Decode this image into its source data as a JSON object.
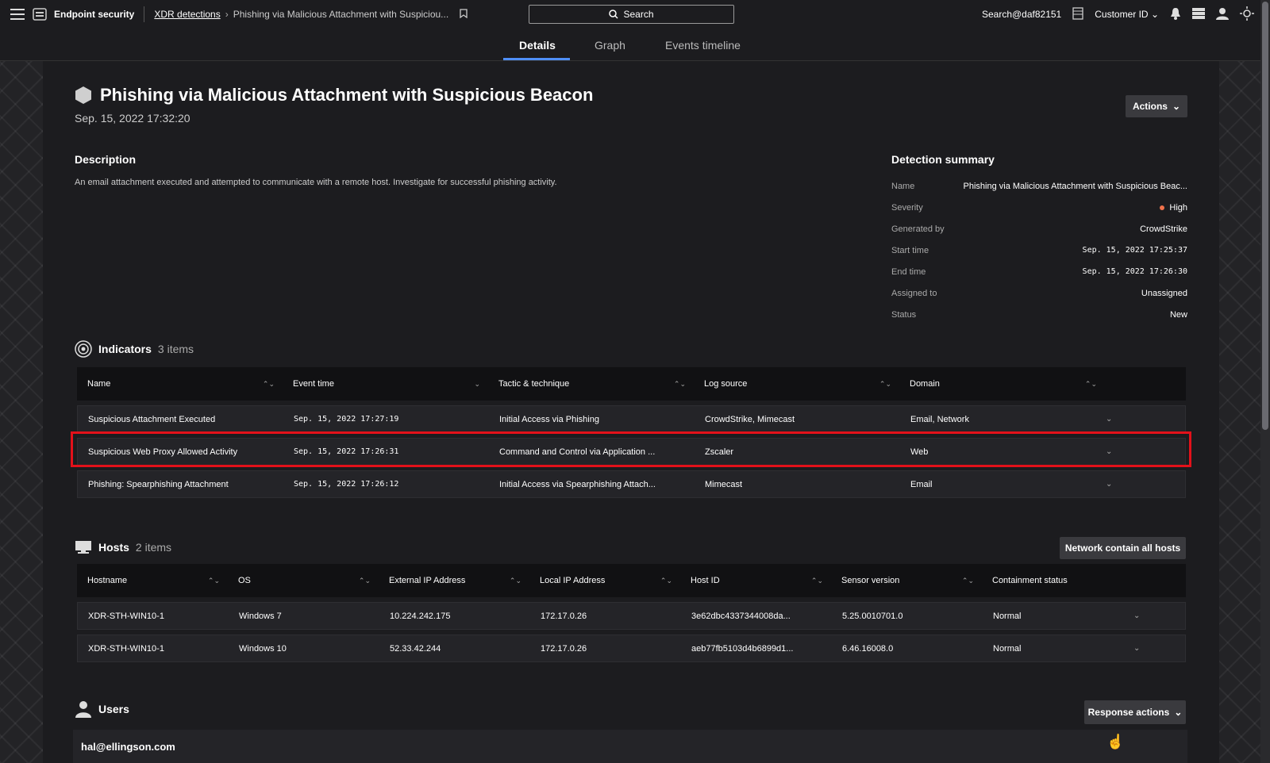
{
  "header": {
    "app_name": "Endpoint security",
    "breadcrumb_link": "XDR detections",
    "breadcrumb_current": "Phishing via Malicious Attachment with Suspiciou...",
    "search_label": "Search",
    "user_label": "Search@daf82151",
    "customer_label": "Customer ID"
  },
  "tabs": [
    {
      "label": "Details",
      "active": true
    },
    {
      "label": "Graph",
      "active": false
    },
    {
      "label": "Events timeline",
      "active": false
    }
  ],
  "detection": {
    "title": "Phishing via Malicious Attachment with Suspicious Beacon",
    "timestamp": "Sep. 15, 2022 17:32:20",
    "actions_label": "Actions",
    "description_heading": "Description",
    "description": "An email attachment executed and attempted to communicate with a remote host. Investigate for successful phishing activity."
  },
  "summary": {
    "heading": "Detection summary",
    "rows": [
      {
        "key": "Name",
        "value": "Phishing via Malicious Attachment with Suspicious Beac..."
      },
      {
        "key": "Severity",
        "value": "High"
      },
      {
        "key": "Generated by",
        "value": "CrowdStrike"
      },
      {
        "key": "Start time",
        "value": "Sep. 15, 2022 17:25:37"
      },
      {
        "key": "End time",
        "value": "Sep. 15, 2022 17:26:30"
      },
      {
        "key": "Assigned to",
        "value": "Unassigned"
      },
      {
        "key": "Status",
        "value": "New"
      }
    ],
    "severity_color": "#f0724b"
  },
  "indicators": {
    "title": "Indicators",
    "count": "3 items",
    "columns": [
      "Name",
      "Event time",
      "Tactic & technique",
      "Log source",
      "Domain"
    ],
    "rows": [
      [
        "Suspicious Attachment Executed",
        "Sep. 15, 2022 17:27:19",
        "Initial Access via Phishing",
        "CrowdStrike, Mimecast",
        "Email, Network"
      ],
      [
        "Suspicious Web Proxy Allowed Activity",
        "Sep. 15, 2022 17:26:31",
        "Command and Control via Application ...",
        "Zscaler",
        "Web"
      ],
      [
        "Phishing: Spearphishing Attachment",
        "Sep. 15, 2022 17:26:12",
        "Initial Access via Spearphishing Attach...",
        "Mimecast",
        "Email"
      ]
    ]
  },
  "hosts": {
    "title": "Hosts",
    "count": "2 items",
    "network_contain_label": "Network contain all hosts",
    "columns": [
      "Hostname",
      "OS",
      "External IP Address",
      "Local IP Address",
      "Host ID",
      "Sensor version",
      "Containment status"
    ],
    "rows": [
      [
        "XDR-STH-WIN10-1",
        "Windows 7",
        "10.224.242.175",
        "172.17.0.26",
        "3e62dbc4337344008da...",
        "5.25.0010701.0",
        "Normal"
      ],
      [
        "XDR-STH-WIN10-1",
        "Windows 10",
        "52.33.42.244",
        "172.17.0.26",
        "aeb77fb5103d4b6899d1...",
        "6.46.16008.0",
        "Normal"
      ]
    ]
  },
  "users": {
    "title": "Users",
    "response_actions_label": "Response actions",
    "first_user": "hal@ellingson.com"
  },
  "colors": {
    "accent": "#4f8ff7",
    "highlight": "#e3111a"
  }
}
